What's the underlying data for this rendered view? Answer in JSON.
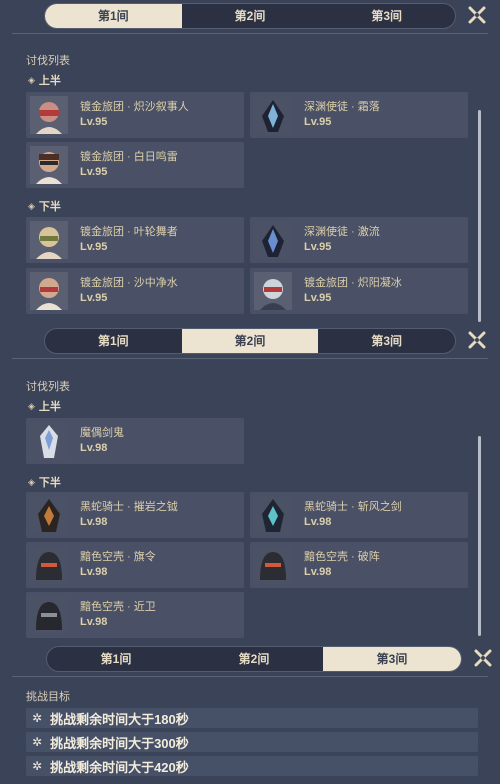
{
  "tabs": [
    "第1间",
    "第2间",
    "第3间"
  ],
  "chamber1": {
    "section": "讨伐列表",
    "first_half": {
      "label": "上半",
      "enemies": [
        {
          "name": "镀金旅团 · 炽沙叙事人",
          "level": "Lv.95"
        },
        {
          "name": "深渊使徒 · 霜落",
          "level": "Lv.95"
        },
        {
          "name": "镀金旅团 · 白日鸣雷",
          "level": "Lv.95"
        }
      ]
    },
    "second_half": {
      "label": "下半",
      "enemies": [
        {
          "name": "镀金旅团 · 叶轮舞者",
          "level": "Lv.95"
        },
        {
          "name": "深渊使徒 · 激流",
          "level": "Lv.95"
        },
        {
          "name": "镀金旅团 · 沙中净水",
          "level": "Lv.95"
        },
        {
          "name": "镀金旅团 · 炽阳凝冰",
          "level": "Lv.95"
        }
      ]
    }
  },
  "chamber2": {
    "section": "讨伐列表",
    "first_half": {
      "label": "上半",
      "enemies": [
        {
          "name": "魔偶剑鬼",
          "level": "Lv.98"
        }
      ]
    },
    "second_half": {
      "label": "下半",
      "enemies": [
        {
          "name": "黑蛇骑士 · 摧岩之钺",
          "level": "Lv.98"
        },
        {
          "name": "黑蛇骑士 · 斩风之剑",
          "level": "Lv.98"
        },
        {
          "name": "黯色空壳 · 旗令",
          "level": "Lv.98"
        },
        {
          "name": "黯色空壳 · 破阵",
          "level": "Lv.98"
        },
        {
          "name": "黯色空壳 · 近卫",
          "level": "Lv.98"
        }
      ]
    }
  },
  "chamber3": {
    "section": "挑战目标",
    "goals": [
      "挑战剩余时间大于180秒",
      "挑战剩余时间大于300秒",
      "挑战剩余时间大于420秒"
    ]
  }
}
